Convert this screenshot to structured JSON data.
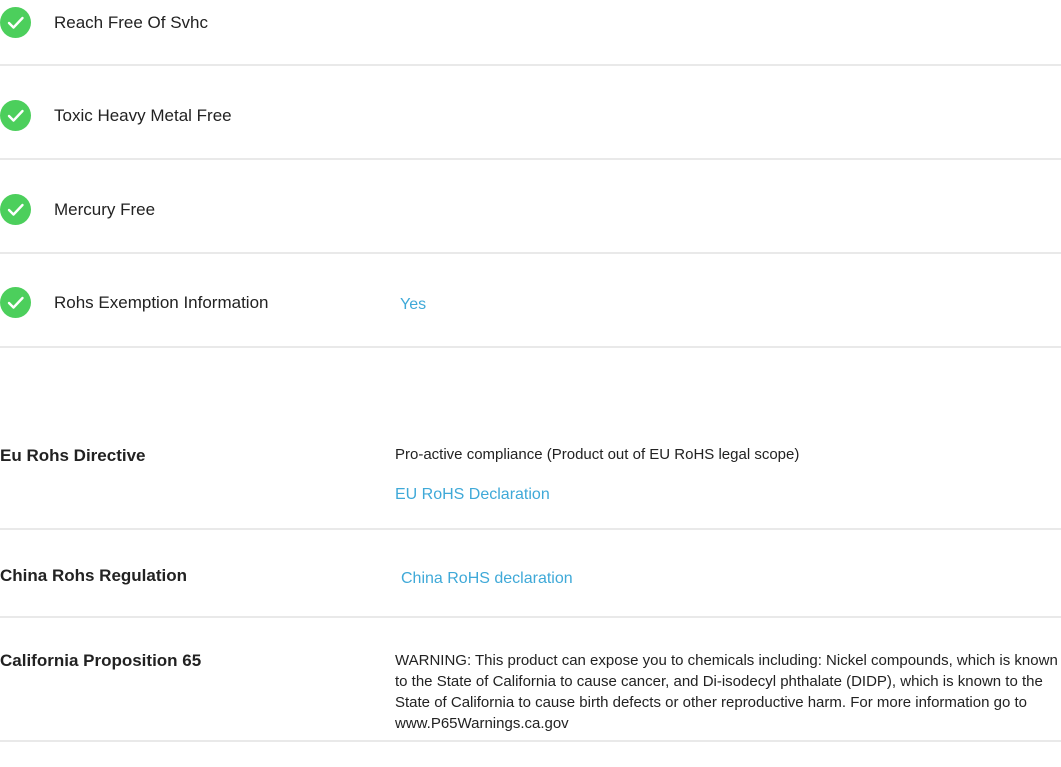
{
  "checklist": [
    {
      "label": "Reach Free Of Svhc",
      "value": "",
      "icon": "check-circle-icon"
    },
    {
      "label": "Toxic Heavy Metal Free",
      "value": "",
      "icon": "check-circle-icon"
    },
    {
      "label": "Mercury Free",
      "value": "",
      "icon": "check-circle-icon"
    },
    {
      "label": "Rohs Exemption Information",
      "value": "Yes",
      "icon": "check-circle-icon"
    }
  ],
  "compliance": [
    {
      "label": "Eu Rohs Directive",
      "text": "Pro-active compliance (Product out of EU RoHS legal scope)",
      "link": "EU RoHS Declaration"
    },
    {
      "label": "China Rohs Regulation",
      "text": "",
      "link": "China RoHS declaration"
    },
    {
      "label": "California Proposition 65",
      "text": "WARNING: This product can expose you to chemicals including: Nickel compounds, which is known to the State of California to cause cancer, and Di-isodecyl phthalate (DIDP), which is known to the State of California to cause birth defects or other reproductive harm. For more information go to www.P65Warnings.ca.gov",
      "link": ""
    }
  ],
  "colors": {
    "check_green": "#4ccf5c",
    "link_blue": "#3fa9d8",
    "divider": "#e9e9e9"
  }
}
